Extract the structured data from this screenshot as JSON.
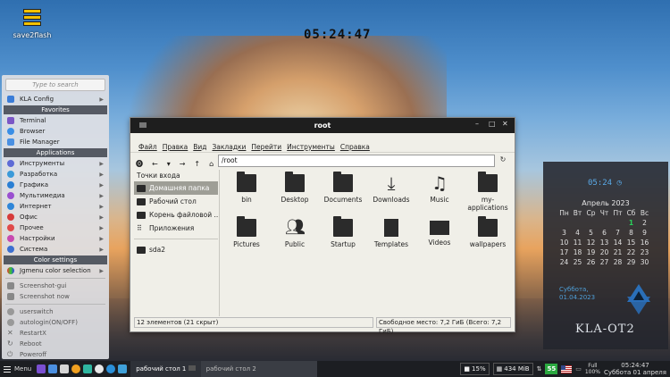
{
  "desktop": {
    "icon_label": "save2flash",
    "clock": "05:24:47"
  },
  "menu": {
    "search_placeholder": "Type to search",
    "top_item": "KLA Config",
    "favorites_header": "Favorites",
    "favorites": [
      "Terminal",
      "Browser",
      "File Manager"
    ],
    "applications_header": "Applications",
    "applications": [
      "Инструменты",
      "Разработка",
      "Графика",
      "Мультимедиа",
      "Интернет",
      "Офис",
      "Прочее",
      "Настройки",
      "Система"
    ],
    "color_header": "Color settings",
    "color_item": "Jgmenu color selection",
    "extra": [
      "Screenshot-gui",
      "Screenshot now"
    ],
    "session": [
      "userswitch",
      "autologin(ON/OFF)",
      "RestartX",
      "Reboot",
      "Poweroff"
    ]
  },
  "filemanager": {
    "title": "root",
    "menubar": [
      "Файл",
      "Правка",
      "Вид",
      "Закладки",
      "Перейти",
      "Инструменты",
      "Справка"
    ],
    "path": "/root",
    "sidebar_header": "Точки входа",
    "sidebar": [
      "Домашняя папка",
      "Рабочий стол",
      "Корень файловой ...",
      "Приложения"
    ],
    "sidebar_extra": "sda2",
    "files": [
      "bin",
      "Desktop",
      "Documents",
      "Downloads",
      "Music",
      "my-applications",
      "Pictures",
      "Public",
      "Startup",
      "Templates",
      "Videos",
      "wallpapers"
    ],
    "status_left": "12 элементов (21 скрыт)",
    "status_right": "Свободное место: 7,2 ГиБ (Всего: 7,2 ГиБ)"
  },
  "calendar": {
    "time": "05:24",
    "month": "Апрель 2023",
    "weekdays": [
      "Пн",
      "Вт",
      "Ср",
      "Чт",
      "Пт",
      "Сб",
      "Вс"
    ],
    "weeks": [
      [
        "",
        "",
        "",
        "",
        "",
        "1",
        "2"
      ],
      [
        "3",
        "4",
        "5",
        "6",
        "7",
        "8",
        "9"
      ],
      [
        "10",
        "11",
        "12",
        "13",
        "14",
        "15",
        "16"
      ],
      [
        "17",
        "18",
        "19",
        "20",
        "21",
        "22",
        "23"
      ],
      [
        "24",
        "25",
        "26",
        "27",
        "28",
        "29",
        "30"
      ]
    ],
    "today": "1",
    "date_line1": "Суббота,",
    "date_line2": "01.04.2023",
    "brand": "KLA-OT2"
  },
  "taskbar": {
    "menu_label": "Menu",
    "desktop1": "рабочий стол 1",
    "desktop2": "рабочий стол 2",
    "volume": "15%",
    "memory": "434 MiB",
    "updates": "55",
    "full_top": "Full",
    "full_bottom": "100%",
    "clock_time": "05:24:47",
    "clock_date": "Суббота 01 апреля"
  },
  "colors": {
    "accent_blue": "#5aa9e6",
    "calendar_today": "#2ad05a",
    "taskbar": "#1c1e22",
    "menu_header": "#555a63"
  }
}
